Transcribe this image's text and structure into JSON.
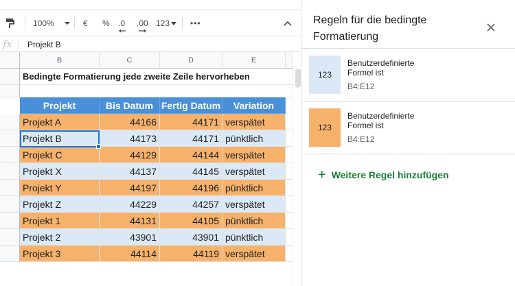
{
  "toolbar": {
    "paint_format_icon": "paint-roller-icon",
    "zoom": "100%",
    "currency": "€",
    "percent": "%",
    "decrease_decimals": ".0",
    "increase_decimals": ".00",
    "number_format": "123",
    "more": "•••",
    "collapse_icon": "chevron-up-icon"
  },
  "formula_bar": {
    "fx": "fx",
    "value": "Projekt B"
  },
  "grid": {
    "columns": [
      "B",
      "C",
      "D",
      "E"
    ],
    "title": "Bedingte Formatierung jede zweite Zeile hervorheben",
    "headers": [
      "Projekt",
      "Bis Datum",
      "Fertig Datum",
      "Variation"
    ],
    "rows": [
      [
        "Projekt A",
        "44166",
        "44171",
        "verspätet"
      ],
      [
        "Projekt B",
        "44173",
        "44171",
        "pünktlich"
      ],
      [
        "Projekt C",
        "44129",
        "44144",
        "verspätet"
      ],
      [
        "Projekt X",
        "44137",
        "44145",
        "verspätet"
      ],
      [
        "Projekt Y",
        "44197",
        "44196",
        "pünktlich"
      ],
      [
        "Projekt Z",
        "44229",
        "44257",
        "verspätet"
      ],
      [
        "Projekt 1",
        "44131",
        "44105",
        "pünktlich"
      ],
      [
        "Projekt 2",
        "43901",
        "43901",
        "pünktlich"
      ],
      [
        "Projekt 3",
        "44114",
        "44119",
        "verspätet"
      ]
    ],
    "colors": {
      "header": "#4a90d9",
      "orange": "#f6b26b",
      "blue": "#dbe9f6"
    },
    "row_fill": [
      "orange",
      "blue",
      "orange",
      "blue",
      "orange",
      "blue",
      "orange",
      "blue",
      "orange"
    ]
  },
  "panel": {
    "title": "Regeln für die bedingte Formatierung",
    "close_icon": "close-icon",
    "rules": [
      {
        "swatch_text": "123",
        "swatch_color": "#dbe9f6",
        "line1": "Benutzerdefinierte",
        "line2": "Formel ist",
        "range": "B4:E12"
      },
      {
        "swatch_text": "123",
        "swatch_color": "#f6b26b",
        "line1": "Benutzerdefinierte",
        "line2": "Formel ist",
        "range": "B4:E12"
      }
    ],
    "add_rule": "Weitere Regel hinzufügen"
  }
}
